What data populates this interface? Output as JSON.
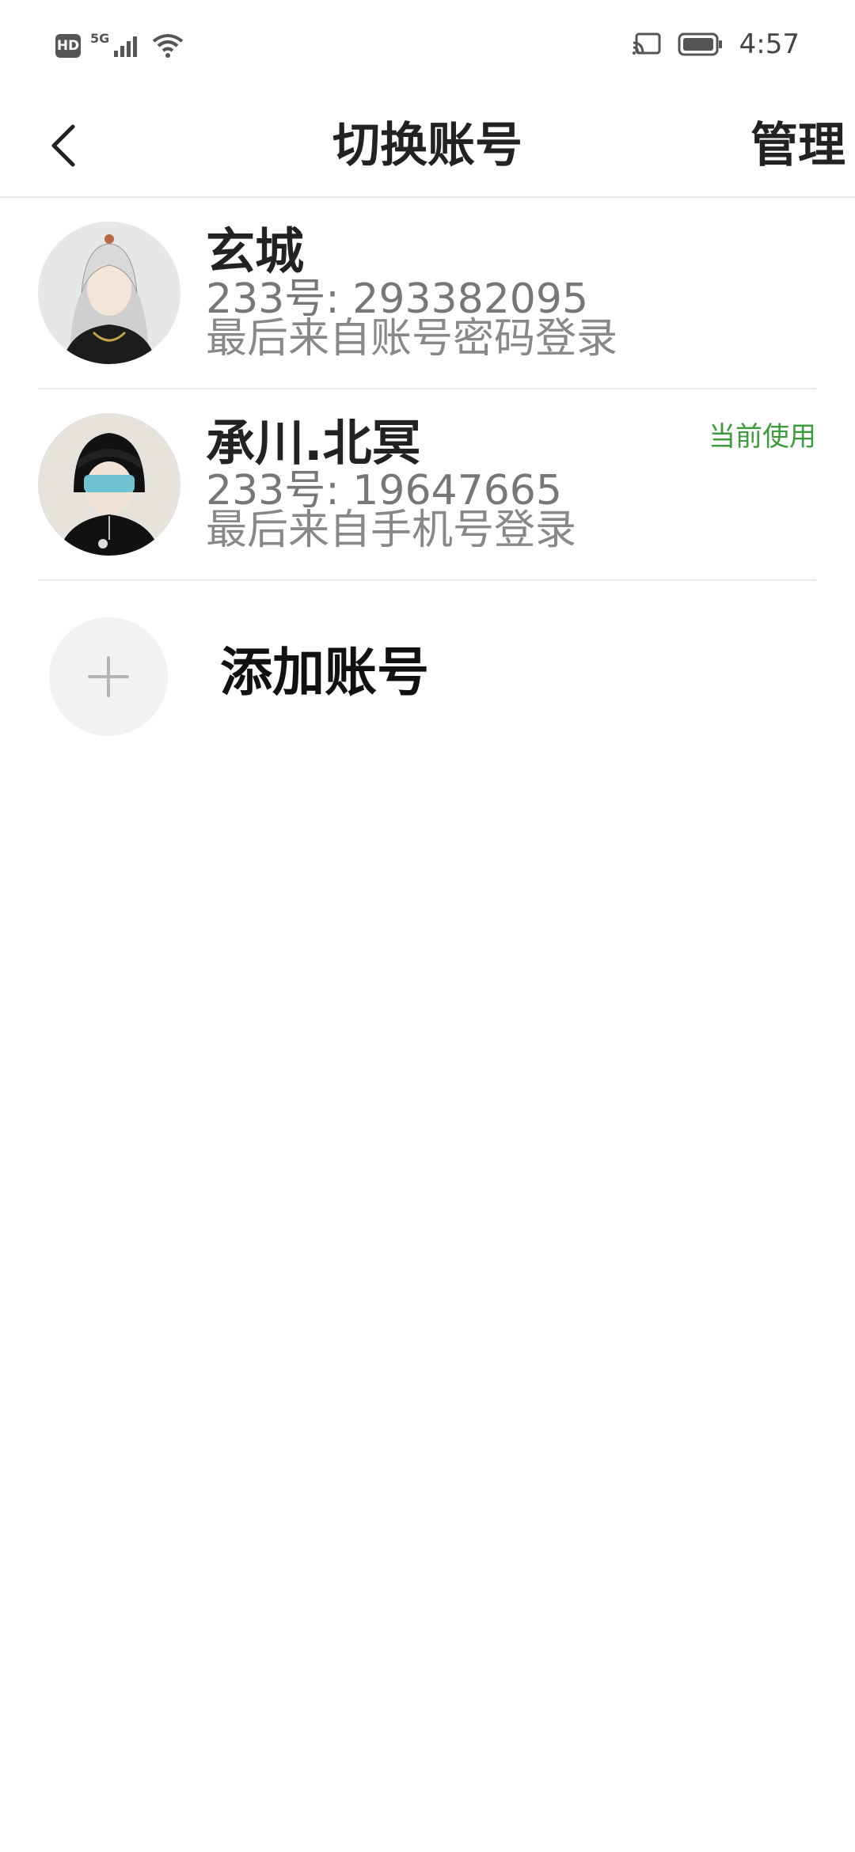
{
  "status_bar": {
    "hd_label": "HD",
    "network_label": "5G",
    "time": "4:57"
  },
  "header": {
    "title": "切换账号",
    "manage_label": "管理"
  },
  "accounts": [
    {
      "name": "玄城",
      "id_text": "233号: 293382095",
      "login_text": "最后来自账号密码登录",
      "current_badge": ""
    },
    {
      "name": "承川.北冥",
      "id_text": "233号: 19647665",
      "login_text": "最后来自手机号登录",
      "current_badge": "当前使用"
    }
  ],
  "add_account": {
    "label": "添加账号"
  },
  "colors": {
    "accent_green": "#3c9b3c",
    "divider": "#ececec",
    "secondary_text": "#888888"
  },
  "icons": {
    "back": "back-arrow-icon",
    "plus": "plus-icon",
    "cast": "cast-icon",
    "battery": "battery-icon",
    "wifi": "wifi-icon",
    "signal": "signal-icon"
  }
}
